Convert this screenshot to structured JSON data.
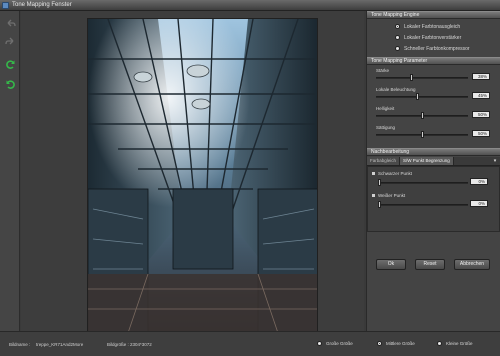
{
  "window": {
    "title": "Tone Mapping Fenster"
  },
  "toolbar": {
    "tools": [
      "undo-icon",
      "redo-icon",
      "refresh-green-icon",
      "reset-green-icon"
    ]
  },
  "panel": {
    "engine_header": "Tone Mapping Engine",
    "engine_options": [
      {
        "label": "Lokaler Farbtonausgleich",
        "selected": true
      },
      {
        "label": "Lokaler Farbtonverstärker",
        "selected": false
      },
      {
        "label": "Schneller Farbtonkompressor",
        "selected": false
      }
    ],
    "params_header": "Tone Mapping Parameter",
    "params": [
      {
        "label": "Stärke",
        "value": "38%",
        "level": 0.38
      },
      {
        "label": "Lokale Beleuchtung",
        "value": "45%",
        "level": 0.45
      },
      {
        "label": "Helligkeit",
        "value": "50%",
        "level": 0.5
      },
      {
        "label": "Sättigung",
        "value": "50%",
        "level": 0.5
      }
    ],
    "post_header": "Nachbearbeitung",
    "tabs": [
      {
        "label": "Farbabgleich",
        "active": false
      },
      {
        "label": "S/W Punkt Begrenzung",
        "active": true
      }
    ],
    "tab_menu": "▾",
    "bw": [
      {
        "label": "Schwarzer Punkt",
        "value": "0%",
        "level": 0.0
      },
      {
        "label": "Weißer Punkt",
        "value": "0%",
        "level": 0.0
      }
    ],
    "buttons": {
      "ok": "Ok",
      "reset": "Reset",
      "cancel": "Abbrechen"
    }
  },
  "status": {
    "filename_label": "Bildname :",
    "filename": "treppe_KR71And2More",
    "size_label": "Bildgröße : 2304*3072",
    "size_options": [
      {
        "label": "Große Größe",
        "selected": false
      },
      {
        "label": "Mittlere Größe",
        "selected": true
      },
      {
        "label": "Kleine Größe",
        "selected": false
      }
    ]
  },
  "colors": {
    "accent_green": "#35b84a",
    "panel_header": "#6a6a6a",
    "background": "#3a3a3a"
  }
}
